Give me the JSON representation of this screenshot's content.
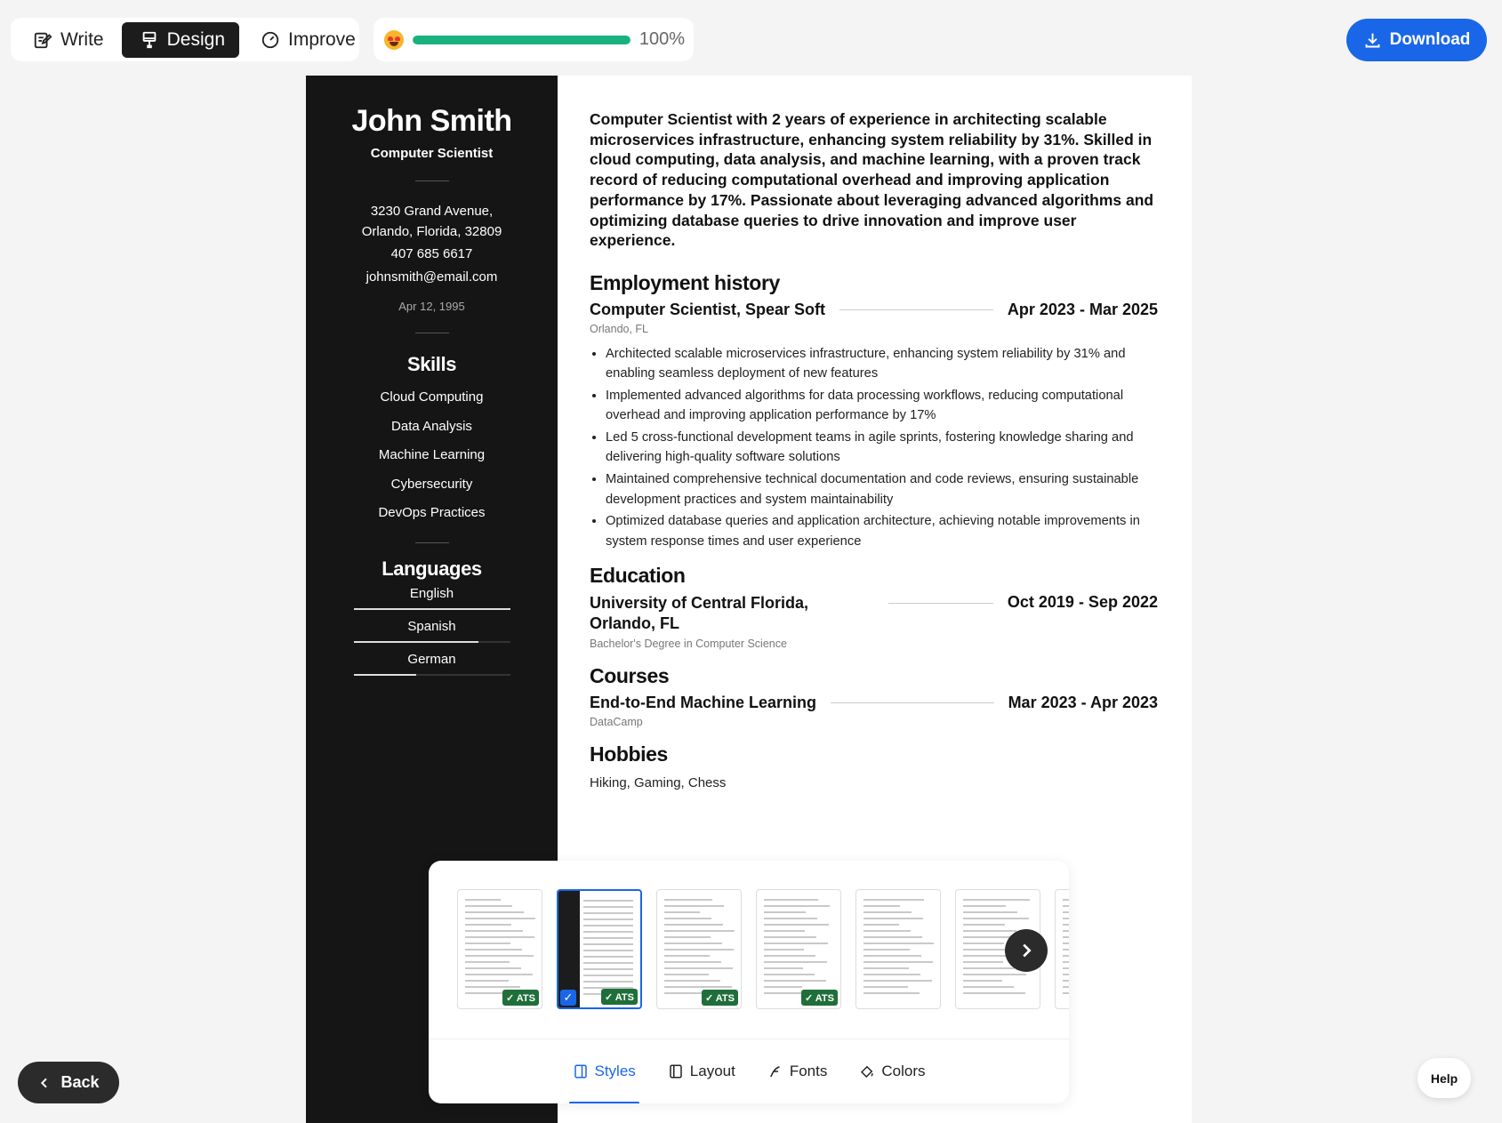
{
  "toolbar": {
    "modes": [
      {
        "label": "Write",
        "icon": "pencil-note-icon"
      },
      {
        "label": "Design",
        "icon": "paint-brush-icon"
      },
      {
        "label": "Improve",
        "icon": "gauge-icon"
      }
    ],
    "active_mode": "Design",
    "progress_label": "100%",
    "progress_value": 1.0,
    "download_label": "Download"
  },
  "resume": {
    "name": "John Smith",
    "role": "Computer Scientist",
    "address": "3230 Grand Avenue, Orlando, Florida, 32809",
    "phone": "407 685 6617",
    "email": "johnsmith@email.com",
    "dob": "Apr 12, 1995",
    "skills_title": "Skills",
    "skills": [
      "Cloud Computing",
      "Data Analysis",
      "Machine Learning",
      "Cybersecurity",
      "DevOps Practices"
    ],
    "languages_title": "Languages",
    "languages": [
      {
        "name": "English",
        "level": 1.0
      },
      {
        "name": "Spanish",
        "level": 0.8
      },
      {
        "name": "German",
        "level": 0.4
      }
    ],
    "summary": "Computer Scientist with 2 years of experience in architecting scalable microservices infrastructure, enhancing system reliability by 31%. Skilled in cloud computing, data analysis, and machine learning, with a proven track record of reducing computational overhead and improving application performance by 17%. Passionate about leveraging advanced algorithms and optimizing database queries to drive innovation and improve user experience.",
    "employment_title": "Employment history",
    "job": {
      "title": "Computer Scientist, Spear Soft",
      "dates": "Apr 2023 - Mar 2025",
      "location": "Orlando, FL",
      "bullets": [
        "Architected scalable microservices infrastructure, enhancing system reliability by 31% and enabling seamless deployment of new features",
        "Implemented advanced algorithms for data processing workflows, reducing computational overhead and improving application performance by 17%",
        "Led 5 cross-functional development teams in agile sprints, fostering knowledge sharing and delivering high-quality software solutions",
        "Maintained comprehensive technical documentation and code reviews, ensuring sustainable development practices and system maintainability",
        "Optimized database queries and application architecture, achieving notable improvements in system response times and user experience"
      ]
    },
    "education_title": "Education",
    "education": {
      "school": "University of Central Florida, Orlando, FL",
      "dates": "Oct 2019 - Sep 2022",
      "degree": "Bachelor's Degree in Computer Science"
    },
    "courses_title": "Courses",
    "course": {
      "name": "End-to-End Machine Learning",
      "dates": "Mar 2023 - Apr 2023",
      "provider": "DataCamp"
    },
    "hobbies_title": "Hobbies",
    "hobbies": "Hiking, Gaming, Chess"
  },
  "design_panel": {
    "ats_label": "ATS",
    "templates": [
      {
        "ats": true,
        "selected": false
      },
      {
        "ats": true,
        "selected": true
      },
      {
        "ats": true,
        "selected": false
      },
      {
        "ats": true,
        "selected": false
      },
      {
        "ats": false,
        "selected": false
      },
      {
        "ats": false,
        "selected": false
      },
      {
        "ats": false,
        "selected": false
      }
    ],
    "tabs": [
      {
        "label": "Styles",
        "icon": "styles-icon"
      },
      {
        "label": "Layout",
        "icon": "layout-icon"
      },
      {
        "label": "Fonts",
        "icon": "font-icon"
      },
      {
        "label": "Colors",
        "icon": "paint-bucket-icon"
      }
    ],
    "active_tab": "Styles"
  },
  "back_label": "Back",
  "help_label": "Help",
  "colors": {
    "accent": "#1a66e8",
    "progress": "#19b27f",
    "sidebar": "#151515"
  }
}
